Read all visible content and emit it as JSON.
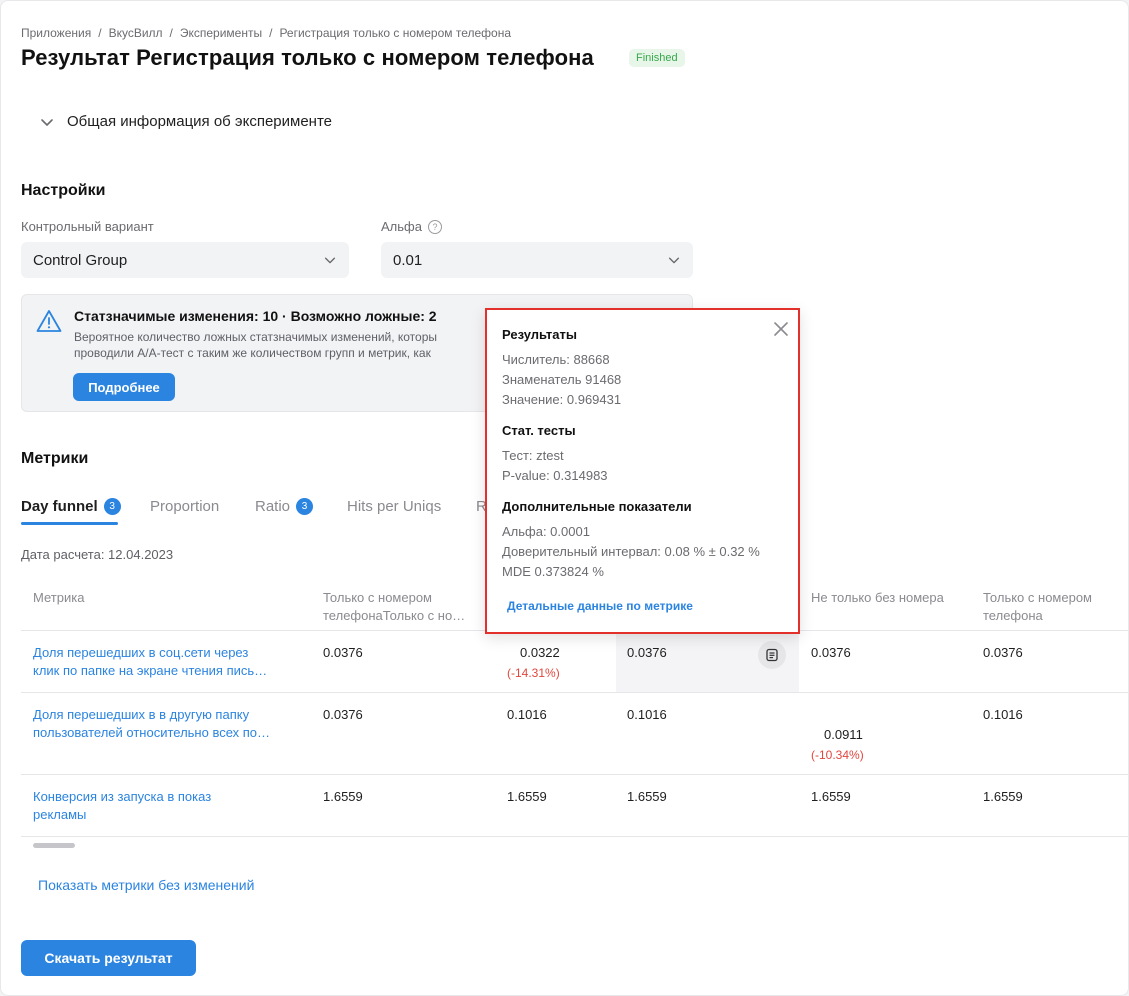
{
  "breadcrumb": [
    "Приложения",
    "ВкусВилл",
    "Эксперименты",
    "Регистрация только с номером телефона"
  ],
  "page_title": "Результат Регистрация только с номером телефона",
  "status_badge": "Finished",
  "accordion_label": "Общая информация об эксперименте",
  "settings": {
    "heading": "Настройки",
    "control_label": "Контрольный вариант",
    "control_value": "Control Group",
    "alpha_label": "Альфа",
    "alpha_value": "0.01"
  },
  "alert": {
    "title": "Статзначимые изменения: 10 · Возможно ложные: 2",
    "line1": "Вероятное количество ложных статзначимых изменений, которы",
    "line2": "проводили А/А-тест с таким же количеством групп и метрик, как",
    "button": "Подробнее"
  },
  "metrics": {
    "heading": "Метрики",
    "tabs": [
      {
        "label": "Day funnel",
        "count": "3"
      },
      {
        "label": "Proportion",
        "count": ""
      },
      {
        "label": "Ratio",
        "count": "3"
      },
      {
        "label": "Hits per Uniqs",
        "count": ""
      },
      {
        "label": "R",
        "count": ""
      }
    ],
    "calc_date": "Дата расчета: 12.04.2023"
  },
  "table": {
    "headers": [
      "Метрика",
      "Только с номером телефонаТолько с но…",
      "",
      "",
      "Не только без номера",
      "Только с номером телефона"
    ],
    "header_col1_line1": "Только с номером",
    "header_col1_line2": "телефонаТолько с но…",
    "header_col5_line1": "Только с номером",
    "header_col5_line2": "телефона",
    "rows": [
      {
        "metric_line1": "Доля перешедших в соц.сети через",
        "metric_line2": "клик по папке на экране чтения пись…",
        "c1": "0.0376",
        "c2": "0.0322",
        "c2_delta": "(-14.31%)",
        "c3": "0.0376",
        "c4": "0.0376",
        "c5": "0.0376"
      },
      {
        "metric_line1": "Доля перешедших в в другую папку",
        "metric_line2": "пользователей относительно всех по…",
        "c1": "0.0376",
        "c2": "0.1016",
        "c3": "0.1016",
        "c4": "0.0911",
        "c4_delta": "(-10.34%)",
        "c5": "0.1016"
      },
      {
        "metric_line1": "Конверсия из запуска в показ",
        "metric_line2": "рекламы",
        "c1": "1.6559",
        "c2": "1.6559",
        "c3": "1.6559",
        "c4": "1.6559",
        "c5": "1.6559"
      }
    ]
  },
  "show_unchanged_link": "Показать метрики без изменений",
  "download_button": "Скачать результат",
  "popover": {
    "results_heading": "Результаты",
    "numerator": "Числитель: 88668",
    "denominator": "Знаменатель 91468",
    "value": "Значение: 0.969431",
    "stat_heading": "Стат. тесты",
    "test": "Тест: ztest",
    "pvalue": "P-value: 0.314983",
    "extra_heading": "Дополнительные показатели",
    "alpha": "Альфа: 0.0001",
    "ci": "Доверительный интервал: 0.08 % ± 0.32 %",
    "mde": "MDE 0.373824 %",
    "details_link": "Детальные данные по метрике"
  },
  "colors": {
    "accent": "#2b84e0",
    "negative": "#e0473e",
    "badge_green": "#37a84a",
    "highlight_border": "#e4302a"
  }
}
